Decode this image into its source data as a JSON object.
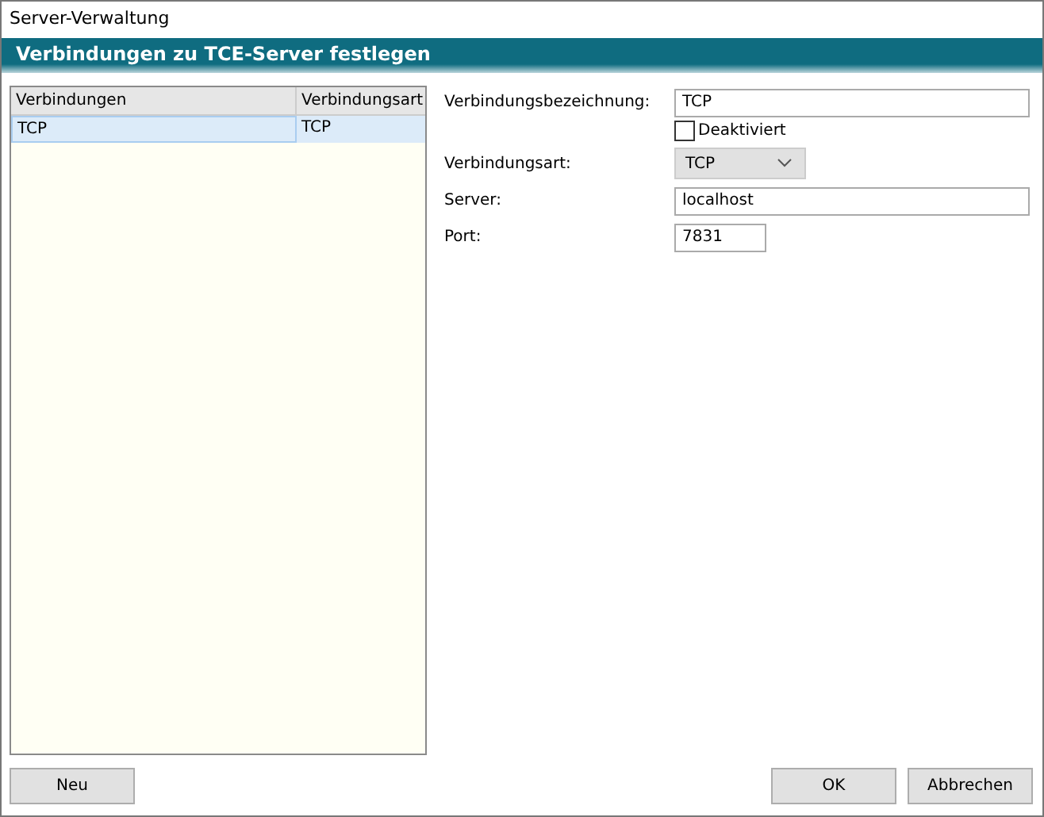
{
  "window": {
    "title": "Server-Verwaltung"
  },
  "header": "Verbindungen zu TCE-Server festlegen",
  "table": {
    "columns": [
      "Verbindungen",
      "Verbindungsart"
    ],
    "rows": [
      {
        "cells": [
          "TCP",
          "TCP"
        ],
        "selected": true
      }
    ]
  },
  "form": {
    "name_label": "Verbindungsbezeichnung:",
    "name_value": "TCP",
    "disabled_label": "Deaktiviert",
    "disabled_checked": false,
    "type_label": "Verbindungsart:",
    "type_value": "TCP",
    "server_label": "Server:",
    "server_value": "localhost",
    "port_label": "Port:",
    "port_value": "7831"
  },
  "buttons": {
    "new": "Neu",
    "ok": "OK",
    "cancel": "Abbrechen"
  }
}
